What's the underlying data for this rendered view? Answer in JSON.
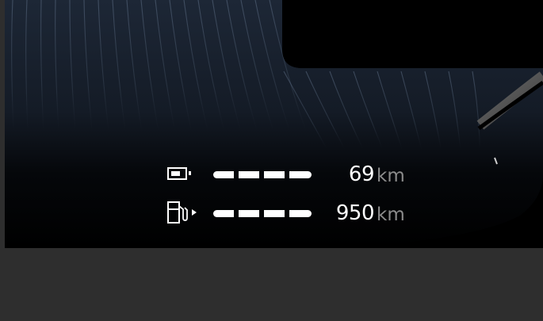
{
  "cluster": {
    "electric_range": {
      "icon": "battery-icon",
      "value": "69",
      "unit": "km",
      "level_fraction": 1.0
    },
    "fuel_range": {
      "icon": "fuel-pump-icon",
      "value": "950",
      "unit": "km",
      "level_fraction": 1.0
    }
  },
  "colors": {
    "background": "#000000",
    "texture": "#1b2431",
    "text": "#ffffff",
    "unit_text": "#8c8c8c",
    "bottom_panel": "#2e2e2e"
  }
}
